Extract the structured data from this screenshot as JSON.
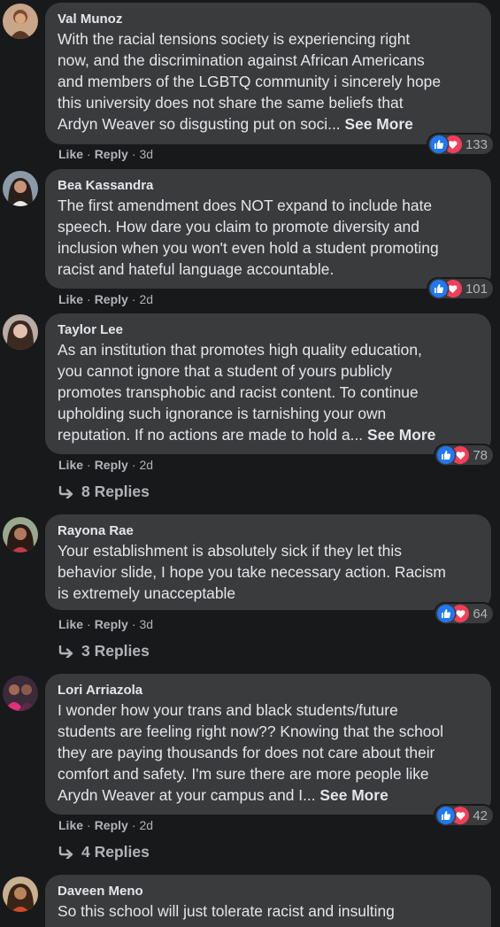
{
  "comments": [
    {
      "author": "Val Munoz",
      "text": "With the racial tensions society is experiencing right\nnow, and the discrimination against African Americans\nand members of the LGBTQ community i sincerely hope\nthis university does not share the same beliefs that\nArdyn Weaver so disgusting put on soci... ",
      "see_more": "See More",
      "reaction_count": "133",
      "like": "Like",
      "reply": "Reply",
      "time": "3d"
    },
    {
      "author": "Bea Kassandra",
      "text": "The first amendment does NOT expand to include hate\nspeech. How dare you claim to promote diversity and\ninclusion when you won't even hold a student promoting\nracist and hateful language accountable.",
      "see_more": "",
      "reaction_count": "101",
      "like": "Like",
      "reply": "Reply",
      "time": "2d"
    },
    {
      "author": "Taylor Lee",
      "text": "As an institution that promotes high quality education,\nyou cannot ignore that a student of yours publicly\npromotes transphobic and racist content. To continue\nupholding such ignorance is tarnishing your own\nreputation. If no actions are made to hold a... ",
      "see_more": "See More",
      "reaction_count": "78",
      "like": "Like",
      "reply": "Reply",
      "time": "2d",
      "replies": "8 Replies"
    },
    {
      "author": "Rayona Rae",
      "text": "Your establishment is absolutely sick if they let this\nbehavior slide, I hope you take necessary action. Racism\nis extremely unacceptable",
      "see_more": "",
      "reaction_count": "64",
      "like": "Like",
      "reply": "Reply",
      "time": "3d",
      "replies": "3 Replies"
    },
    {
      "author": "Lori Arriazola",
      "text": "I wonder how your trans and black students/future\nstudents are feeling right now?? Knowing that the school\nthey are paying thousands for does not care about their\ncomfort and safety. I'm sure there are more people like\nArydn Weaver at your campus and I... ",
      "see_more": "See More",
      "reaction_count": "42",
      "like": "Like",
      "reply": "Reply",
      "time": "2d",
      "replies": "4 Replies"
    },
    {
      "author": "Daveen Meno",
      "text": "So this school will just tolerate racist and insulting",
      "see_more": ""
    }
  ],
  "icons": {
    "like_reaction": "thumbs-up-icon",
    "love_reaction": "heart-icon",
    "reply_arrow": "reply-arrow-icon"
  },
  "colors": {
    "background": "#18191a",
    "bubble": "#3a3b3c",
    "like_blue": "#2078f4",
    "love_red": "#f33e58"
  }
}
